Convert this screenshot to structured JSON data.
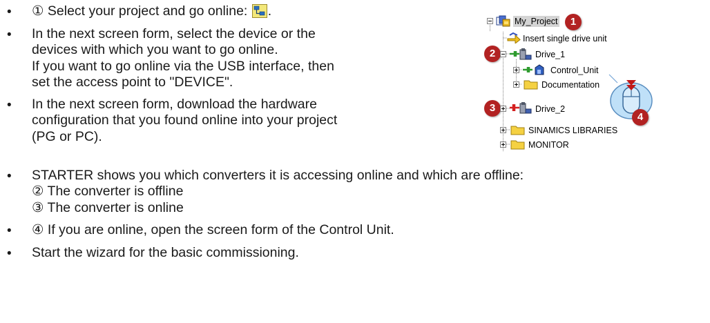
{
  "instructions": {
    "step1_text": "① Select your project and go online:",
    "step1_end": ".",
    "step2_lines": [
      "In the next screen form, select the device or the",
      "devices with which you want to go online.",
      "If you want to go online via the USB interface, then",
      "set the access point to \"DEVICE\"."
    ],
    "step3_lines": [
      "In the next screen form, download the hardware",
      "configuration that you found online into your project",
      "(PG or PC)."
    ],
    "step4_text": "STARTER shows you which converters it is accessing online and which are offline:",
    "step4_sub": [
      "② The converter is offline",
      "③ The converter is online"
    ],
    "step5_text": "④ If you are online, open the screen form of the Control Unit.",
    "step6_text": "Start the wizard for the basic commissioning.",
    "bullet": "•"
  },
  "tree": {
    "items": [
      {
        "label": "My_Project",
        "icon": "project-icon",
        "expander": "minus"
      },
      {
        "label": "Insert single drive unit",
        "icon": "insert-drive-icon",
        "expander": "none"
      },
      {
        "label": "Drive_1",
        "icon": "drive-offline-icon",
        "expander": "minus"
      },
      {
        "label": "Control_Unit",
        "icon": "control-unit-icon",
        "expander": "plus"
      },
      {
        "label": "Documentation",
        "icon": "folder-icon",
        "expander": "plus"
      },
      {
        "label": "Drive_2",
        "icon": "drive-online-icon",
        "expander": "plus"
      },
      {
        "label": "SINAMICS LIBRARIES",
        "icon": "folder-icon",
        "expander": "plus"
      },
      {
        "label": "MONITOR",
        "icon": "folder-icon",
        "expander": "plus"
      }
    ],
    "callouts": [
      "1",
      "2",
      "3",
      "4"
    ],
    "mouse_icon": "mouse-double-click-icon"
  },
  "colors": {
    "callout": "#b22222",
    "online_green": "#2e9b2e",
    "online_red": "#d42020",
    "folder_yellow": "#f5d142",
    "selection_gray": "#d4d4d4",
    "mouse_blue": "#8fc4ee"
  }
}
